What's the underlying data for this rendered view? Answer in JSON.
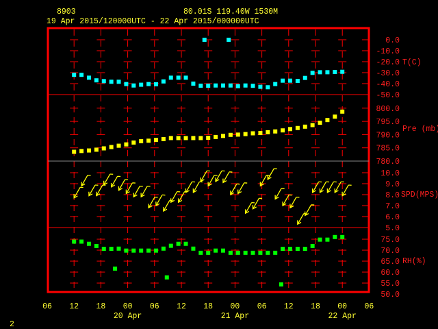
{
  "header": {
    "station_id": "8903",
    "location": "80.01S   119.40W   1530M",
    "period": "19 Apr 2015/120000UTC - 22 Apr 2015/000000UTC"
  },
  "footer_label": "2",
  "colors": {
    "frame": "#ff0000",
    "text": "#ffff33",
    "temperature": "#00ffff",
    "pressure": "#ffff00",
    "wind": "#ffff00",
    "rh": "#00ff00"
  },
  "chart_data": {
    "type": "scatter",
    "x_axis": {
      "range": [
        "2015-04-19 06:00",
        "2015-04-22 06:00"
      ],
      "tick_labels": [
        "06",
        "12",
        "18",
        "00",
        "06",
        "12",
        "18",
        "00",
        "06",
        "12",
        "18",
        "00",
        "06"
      ],
      "date_labels": [
        {
          "text": "20 Apr",
          "at": "2015-04-20 00:00"
        },
        {
          "text": "21 Apr",
          "at": "2015-04-21 00:00"
        },
        {
          "text": "22 Apr",
          "at": "2015-04-22 00:00"
        }
      ]
    },
    "times": [
      "2015-04-19 12:00",
      "2015-04-19 13:40",
      "2015-04-19 15:20",
      "2015-04-19 17:00",
      "2015-04-19 18:40",
      "2015-04-19 20:20",
      "2015-04-19 22:00",
      "2015-04-19 23:40",
      "2015-04-20 01:20",
      "2015-04-20 03:00",
      "2015-04-20 04:40",
      "2015-04-20 06:20",
      "2015-04-20 08:00",
      "2015-04-20 09:40",
      "2015-04-20 11:20",
      "2015-04-20 13:00",
      "2015-04-20 14:40",
      "2015-04-20 16:20",
      "2015-04-20 18:00",
      "2015-04-20 19:40",
      "2015-04-20 21:20",
      "2015-04-20 23:00",
      "2015-04-21 00:40",
      "2015-04-21 02:20",
      "2015-04-21 04:00",
      "2015-04-21 05:40",
      "2015-04-21 07:20",
      "2015-04-21 09:00",
      "2015-04-21 10:40",
      "2015-04-21 12:20",
      "2015-04-21 14:00",
      "2015-04-21 15:40",
      "2015-04-21 17:20",
      "2015-04-21 19:00",
      "2015-04-21 20:40",
      "2015-04-21 22:20",
      "2015-04-22 00:00"
    ],
    "panels": [
      {
        "key": "temp",
        "label": "T(C)",
        "ylim": [
          -50,
          0
        ],
        "tick_labels": [
          "0.0",
          "-10.0",
          "-20.0",
          "-30.0",
          "-40.0",
          "-50.0"
        ],
        "tick_values": [
          0,
          -10,
          -20,
          -30,
          -40,
          -50
        ],
        "values": [
          -32,
          -32,
          -34.6,
          -37,
          -37.7,
          -38.3,
          -38.3,
          -40.4,
          -41.7,
          -41,
          -40.4,
          -40.6,
          -38,
          -34.6,
          -34.6,
          -34.6,
          -40,
          -41.9,
          -41.9,
          -41.7,
          -41.7,
          -41.7,
          -42.3,
          -41.7,
          -42,
          -42.9,
          -43.3,
          -40.4,
          -37.3,
          -37.3,
          -37.5,
          -34.8,
          -30.2,
          -29.6,
          -29.6,
          -29.4,
          -29.2
        ],
        "extra_points": [
          {
            "t": "2015-04-20 17:10",
            "v": 0
          },
          {
            "t": "2015-04-20 22:35",
            "v": 0
          }
        ]
      },
      {
        "key": "pres",
        "label": "Pre (mb)",
        "ylim": [
          780,
          805
        ],
        "tick_labels": [
          "800.0",
          "795.0",
          "790.0",
          "785.0",
          "780.0"
        ],
        "tick_values": [
          800,
          795,
          790,
          785,
          780
        ],
        "values": [
          783.5,
          783.8,
          784.0,
          784.3,
          784.8,
          785.3,
          785.8,
          786.3,
          787.0,
          787.5,
          787.7,
          788.0,
          788.3,
          788.7,
          788.7,
          788.7,
          788.7,
          788.7,
          788.8,
          789.1,
          789.5,
          789.9,
          790.0,
          790.2,
          790.5,
          790.6,
          790.9,
          791.2,
          791.6,
          792.1,
          792.5,
          793.0,
          793.6,
          794.5,
          795.5,
          796.8,
          798.7
        ],
        "extra_points": []
      },
      {
        "key": "spd",
        "label": "SPD(MPS)",
        "ylim": [
          5,
          11
        ],
        "tick_labels": [
          "10.0",
          "9.0",
          "8.0",
          "7.0",
          "6.0",
          "5.0"
        ],
        "tick_values": [
          10,
          9,
          8,
          7,
          6,
          5
        ],
        "values": [
          7.7,
          8.8,
          7.9,
          7.9,
          8.9,
          8.7,
          8.4,
          8.1,
          7.8,
          7.8,
          6.8,
          7.0,
          6.5,
          7.3,
          7.3,
          8.2,
          8.2,
          9.2,
          8.8,
          9.2,
          9.1,
          8.0,
          8.1,
          6.3,
          6.7,
          8.8,
          9.4,
          7.6,
          7.0,
          6.8,
          5.3,
          6.1,
          8.2,
          8.2,
          8.2,
          8.2,
          7.9
        ],
        "wind_direction_deg": 30,
        "extra_points": []
      },
      {
        "key": "rh",
        "label": "RH(%)",
        "ylim": [
          50,
          80
        ],
        "tick_labels": [
          "75.0",
          "70.0",
          "65.0",
          "60.0",
          "55.0",
          "50.0"
        ],
        "tick_values": [
          75,
          70,
          65,
          60,
          55,
          50
        ],
        "values": [
          73.9,
          73.9,
          72.9,
          71.9,
          70.6,
          70.6,
          70.7,
          69.8,
          69.8,
          69.8,
          69.8,
          69.8,
          70.7,
          72.0,
          72.9,
          72.9,
          70.7,
          68.8,
          68.8,
          69.8,
          69.8,
          68.8,
          68.8,
          68.8,
          68.8,
          68.8,
          68.8,
          68.8,
          70.6,
          70.6,
          70.6,
          70.6,
          71.9,
          74.8,
          74.8,
          76.0,
          76.0
        ],
        "extra_points": [
          {
            "t": "2015-04-19 21:10",
            "v": 61.6
          },
          {
            "t": "2015-04-20 08:45",
            "v": 57.6
          },
          {
            "t": "2015-04-21 10:20",
            "v": 54.4
          }
        ]
      }
    ]
  }
}
